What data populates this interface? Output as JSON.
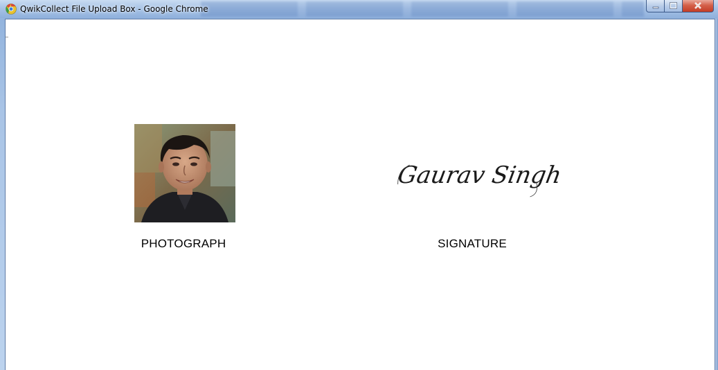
{
  "window": {
    "title": "QwikCollect File Upload Box - Google Chrome",
    "icon": "chrome-icon",
    "controls": [
      "minimize-icon",
      "maximize-icon",
      "close-icon"
    ]
  },
  "content": {
    "photograph": {
      "label": "PHOTOGRAPH"
    },
    "signature": {
      "handwritten_text": "Gaurav Singh",
      "label": "SIGNATURE"
    }
  },
  "colors": {
    "titlebar": "#a7c3e6",
    "close_button": "#c33d26",
    "content_background": "#ffffff"
  }
}
